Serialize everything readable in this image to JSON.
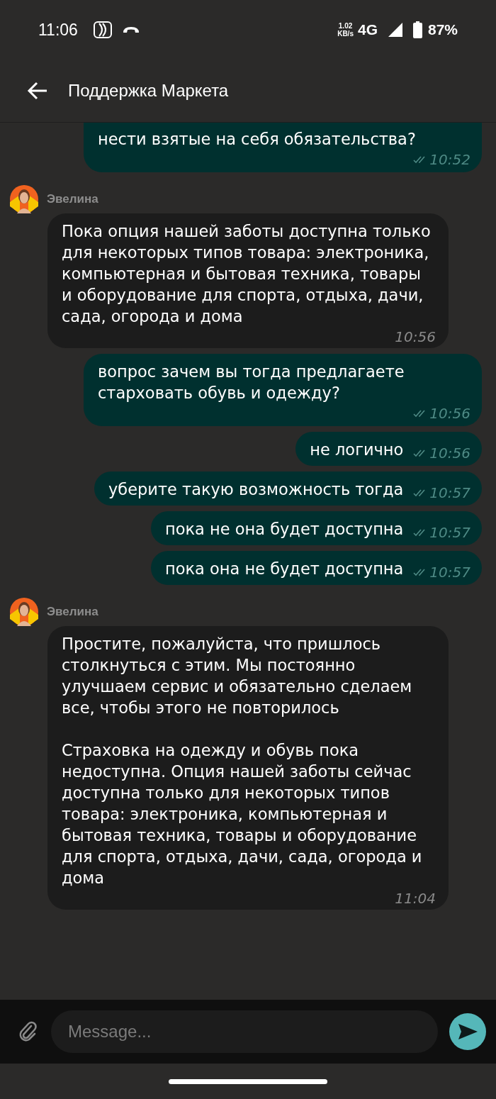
{
  "status_bar": {
    "time": "11:06",
    "speed_value": "1.02",
    "speed_unit": "KB/s",
    "network": "4G",
    "battery": "87%"
  },
  "header": {
    "title": "Поддержка Маркета"
  },
  "messages": [
    {
      "kind": "outgoing",
      "text": "нести взятые на себя обязательства?",
      "time": "10:52",
      "cut": true
    },
    {
      "kind": "incoming",
      "sender": "Эвелина",
      "text": "Пока опция нашей заботы доступна только для некоторых типов товара: электроника, компьютерная и бытовая техника, товары и оборудование для спорта, отдыха, дачи, сада, огорода и дома",
      "time": "10:56"
    },
    {
      "kind": "outgoing",
      "text": "вопрос зачем вы тогда предлагаете старховать обувь и одежду?",
      "time": "10:56"
    },
    {
      "kind": "outgoing",
      "text": "не логично",
      "time": "10:56"
    },
    {
      "kind": "outgoing",
      "text": "уберите такую возможность тогда",
      "time": "10:57"
    },
    {
      "kind": "outgoing",
      "text": "пока не она будет доступна",
      "time": "10:57"
    },
    {
      "kind": "outgoing",
      "text": "пока она не будет доступна",
      "time": "10:57"
    },
    {
      "kind": "incoming",
      "sender": "Эвелина",
      "text": "Простите, пожалуйста, что пришлось столкнуться с этим. Мы постоянно улучшаем сервис и обязательно сделаем все, чтобы этого не повторилось\n\nСтраховка на одежду и обувь пока недоступна. Опция нашей заботы сейчас доступна только для некоторых типов товара: электроника, компьютерная и бытовая техника, товары и оборудование для спорта, отдыха, дачи, сада, огорода и дома",
      "time": "11:04"
    }
  ],
  "composer": {
    "placeholder": "Message..."
  }
}
